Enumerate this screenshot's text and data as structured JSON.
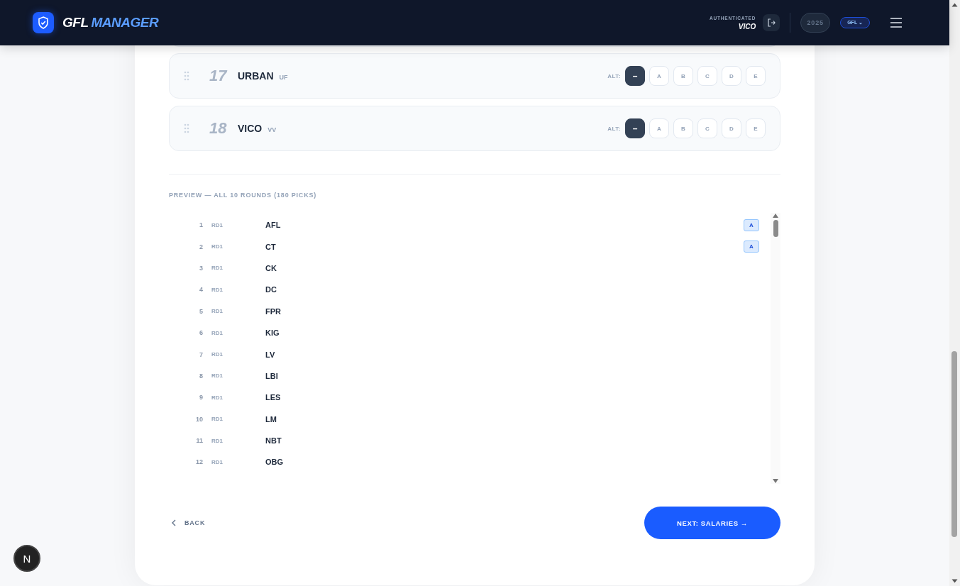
{
  "header": {
    "brand_first": "GFL",
    "brand_second": "MANAGER",
    "auth_label": "AUTHENTICATED",
    "user": "VICO",
    "year": "2025",
    "league": "GFL",
    "league_caret": "⌄"
  },
  "teams": [
    {
      "number": "17",
      "name": "URBAN",
      "code": "UF",
      "alt_label": "ALT:",
      "options": [
        {
          "label": "–",
          "selected": true
        },
        {
          "label": "A",
          "selected": false
        },
        {
          "label": "B",
          "selected": false
        },
        {
          "label": "C",
          "selected": false
        },
        {
          "label": "D",
          "selected": false
        },
        {
          "label": "E",
          "selected": false
        }
      ]
    },
    {
      "number": "18",
      "name": "VICO",
      "code": "VV",
      "alt_label": "ALT:",
      "options": [
        {
          "label": "–",
          "selected": true
        },
        {
          "label": "A",
          "selected": false
        },
        {
          "label": "B",
          "selected": false
        },
        {
          "label": "C",
          "selected": false
        },
        {
          "label": "D",
          "selected": false
        },
        {
          "label": "E",
          "selected": false
        }
      ]
    }
  ],
  "preview": {
    "title": "PREVIEW — ALL 10 ROUNDS (180 PICKS)",
    "picks": [
      {
        "number": "1",
        "round": "RD1",
        "team": "AFL",
        "alt": "A"
      },
      {
        "number": "2",
        "round": "RD1",
        "team": "CT",
        "alt": "A"
      },
      {
        "number": "3",
        "round": "RD1",
        "team": "CK"
      },
      {
        "number": "4",
        "round": "RD1",
        "team": "DC"
      },
      {
        "number": "5",
        "round": "RD1",
        "team": "FPR"
      },
      {
        "number": "6",
        "round": "RD1",
        "team": "KIG"
      },
      {
        "number": "7",
        "round": "RD1",
        "team": "LV"
      },
      {
        "number": "8",
        "round": "RD1",
        "team": "LBI"
      },
      {
        "number": "9",
        "round": "RD1",
        "team": "LES"
      },
      {
        "number": "10",
        "round": "RD1",
        "team": "LM"
      },
      {
        "number": "11",
        "round": "RD1",
        "team": "NBT"
      },
      {
        "number": "12",
        "round": "RD1",
        "team": "OBG"
      }
    ]
  },
  "footer": {
    "back": "BACK",
    "next": "NEXT: SALARIES →"
  },
  "dev_badge": "N"
}
